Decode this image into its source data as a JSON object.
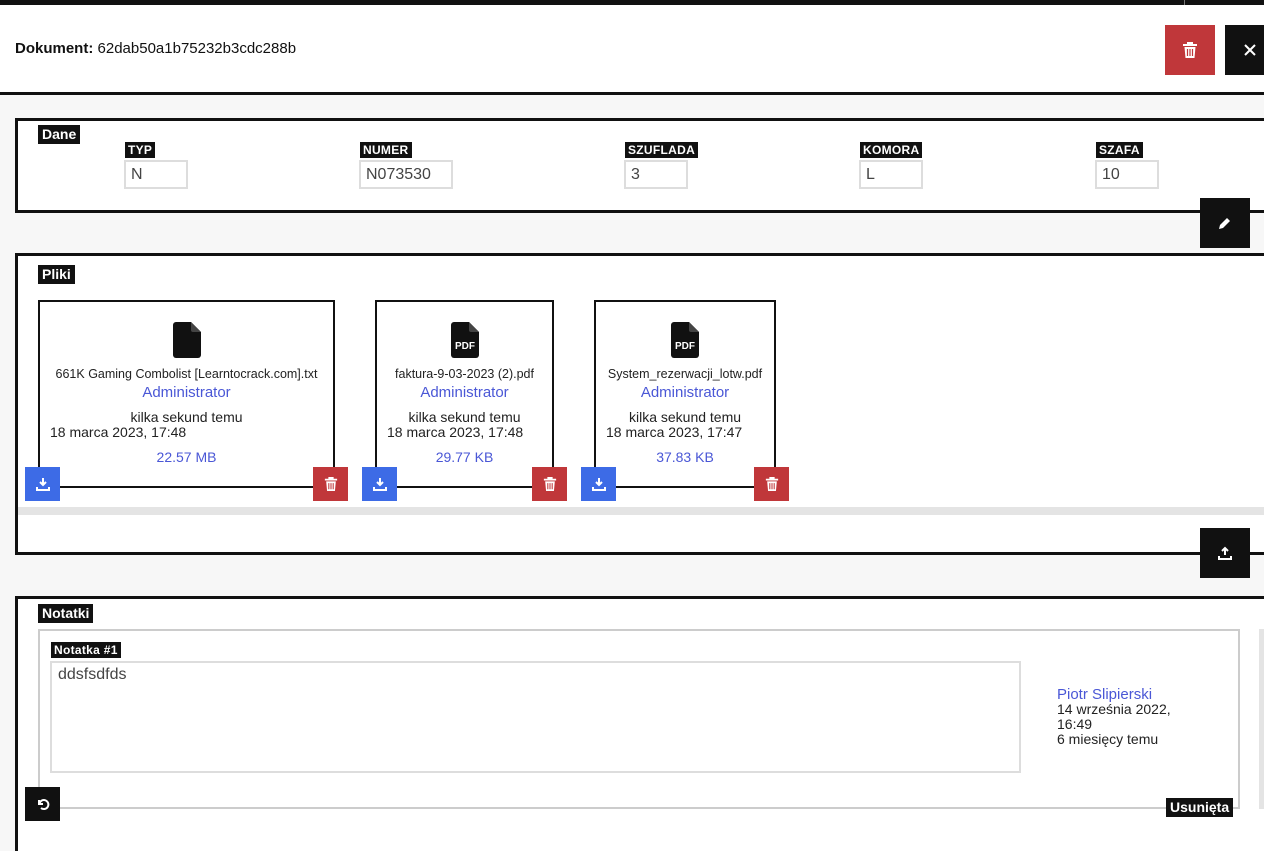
{
  "header": {
    "doc_label": "Dokument:",
    "doc_id": "62dab50a1b75232b3cdc288b"
  },
  "dane": {
    "title": "Dane",
    "fields": [
      {
        "label": "TYP",
        "value": "N"
      },
      {
        "label": "NUMER",
        "value": "N073530"
      },
      {
        "label": "SZUFLADA",
        "value": "3"
      },
      {
        "label": "KOMORA",
        "value": "L"
      },
      {
        "label": "SZAFA",
        "value": "10"
      }
    ]
  },
  "pliki": {
    "title": "Pliki",
    "files": [
      {
        "name": "661K Gaming Combolist [Learntocrack.com].txt",
        "user": "Administrator",
        "ago": "kilka sekund temu",
        "date": "18 marca 2023, 17:48",
        "size": "22.57 MB",
        "icon": "file-icon"
      },
      {
        "name": "faktura-9-03-2023 (2).pdf",
        "user": "Administrator",
        "ago": "kilka sekund temu",
        "date": "18 marca 2023, 17:48",
        "size": "29.77 KB",
        "icon": "pdf-icon"
      },
      {
        "name": "System_rezerwacji_lotw.pdf",
        "user": "Administrator",
        "ago": "kilka sekund temu",
        "date": "18 marca 2023, 17:47",
        "size": "37.83 KB",
        "icon": "pdf-icon"
      }
    ]
  },
  "notatki": {
    "title": "Notatki",
    "notes": [
      {
        "label": "Notatka #1",
        "text": "ddsfsdfds",
        "author": "Piotr Slipierski",
        "date_line1": "14 września 2022,",
        "date_line2": "16:49",
        "ago": "6 miesięcy temu",
        "status": "Usunięta"
      }
    ]
  },
  "colors": {
    "danger": "#c0373a",
    "primary": "#3d6be6",
    "link": "#4a57d6",
    "dark": "#111111"
  },
  "pdf_glyph": "PDF"
}
